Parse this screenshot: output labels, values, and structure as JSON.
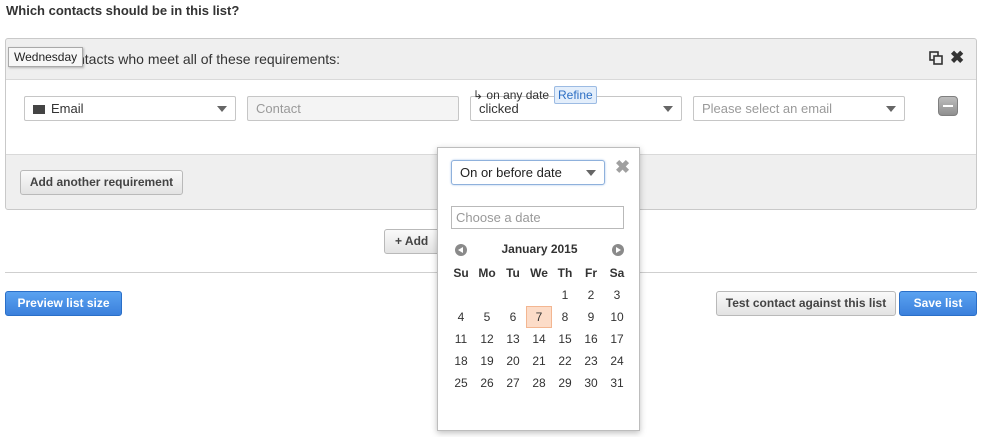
{
  "page": {
    "title": "Which contacts should be in this list?"
  },
  "group": {
    "label": "Contacts who meet all of these requirements:",
    "label_visible": "ntacts who meet all of these requirements:",
    "tooltip": "Wednesday"
  },
  "requirement": {
    "type_value": "Email",
    "type_icon": "envelope-icon",
    "contact_placeholder": "Contact",
    "action_value": "clicked",
    "email_placeholder": "Please select an email",
    "date_note": "↳ on any date",
    "refine_label": "Refine"
  },
  "buttons": {
    "add_requirement": "Add another requirement",
    "add_group": "+  Add",
    "preview": "Preview list size",
    "test_contact": "Test contact against this list",
    "save": "Save list"
  },
  "date_popup": {
    "operator_value": "On or before date",
    "date_placeholder": "Choose a date",
    "month_title": "January 2015",
    "weekdays": [
      "Su",
      "Mo",
      "Tu",
      "We",
      "Th",
      "Fr",
      "Sa"
    ],
    "weeks": [
      [
        "",
        "",
        "",
        "",
        "1",
        "2",
        "3"
      ],
      [
        "4",
        "5",
        "6",
        "7",
        "8",
        "9",
        "10"
      ],
      [
        "11",
        "12",
        "13",
        "14",
        "15",
        "16",
        "17"
      ],
      [
        "18",
        "19",
        "20",
        "21",
        "22",
        "23",
        "24"
      ],
      [
        "25",
        "26",
        "27",
        "28",
        "29",
        "30",
        "31"
      ]
    ],
    "highlighted_day": "7"
  },
  "colors": {
    "primary_button": "#3b80dc",
    "highlight_day": "#fcdcc8",
    "refine_bg": "#e3eefb"
  }
}
